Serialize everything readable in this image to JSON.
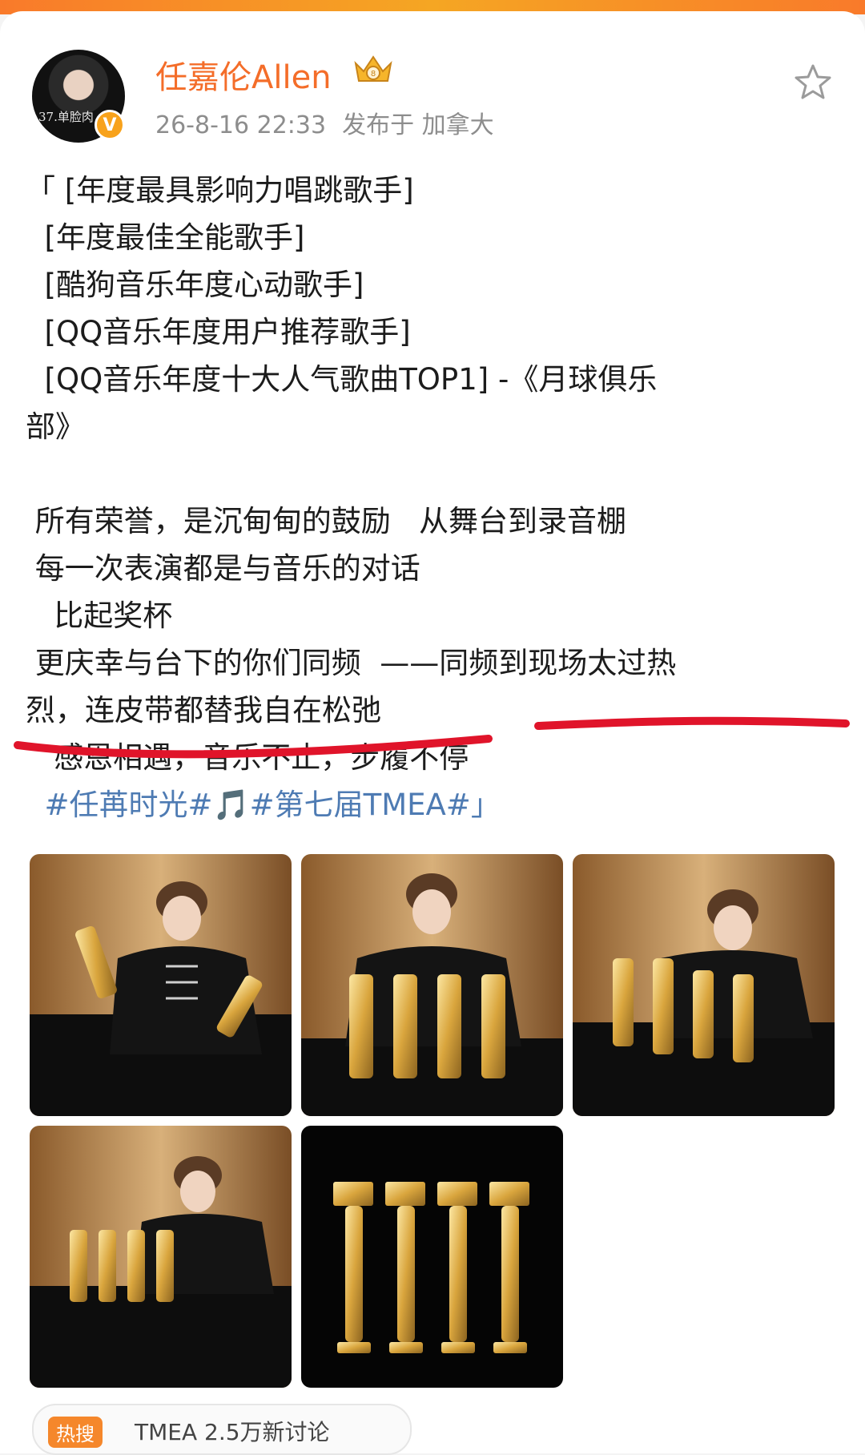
{
  "post": {
    "author_name": "任嘉伦Allen",
    "avatar_caption": "37.单脸肉",
    "meta": {
      "time": "26-8-16 22:33",
      "location": "发布于 加拿大"
    },
    "lines": [
      "「 [年度最具影响力唱跳歌手]",
      "  [年度最佳全能歌手]",
      "  [酷狗音乐年度心动歌手]",
      "  [QQ音乐年度用户推荐歌手]",
      "  [QQ音乐年度十大人气歌曲TOP1] -《月球俱乐",
      "部》",
      "",
      " 所有荣誉，是沉甸甸的鼓励   从舞台到录音棚",
      " 每一次表演都是与音乐的对话",
      "   比起奖杯",
      " 更庆幸与台下的你们同频  ——同频到现场太过热",
      "烈，连皮带都替我自在松弛",
      "   感恩相遇，音乐不止，步履不停"
    ],
    "hashtag_line": "  #任苒时光#🎵#第七届TMEA#」"
  },
  "bottom_chip": {
    "tag": "热搜",
    "text": "TMEA  2.5万新讨论"
  },
  "icons": {
    "crown": "crown-badge-icon",
    "verified": "verified-v-icon",
    "favorite": "star-icon"
  },
  "colors": {
    "name": "#f46d29",
    "hashtag": "#4e7bb3",
    "underline": "#e0142a"
  }
}
